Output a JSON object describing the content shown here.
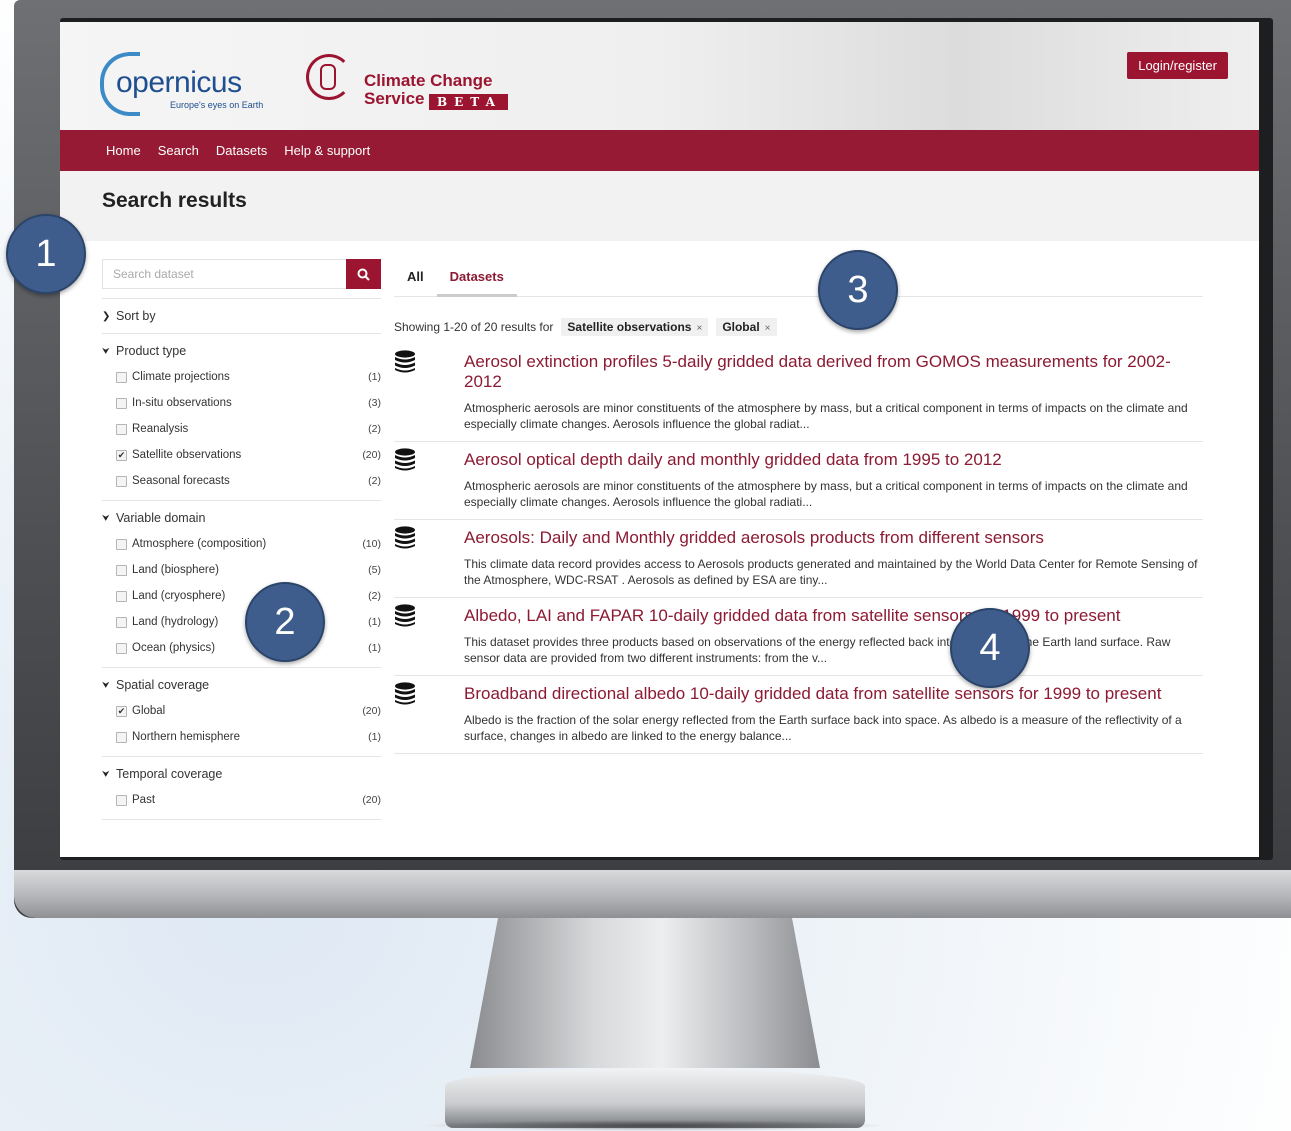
{
  "header": {
    "copernicus_word": "opernicus",
    "copernicus_tagline": "Europe's eyes on Earth",
    "c3s_line1": "Climate Change",
    "c3s_line2": "Service",
    "c3s_beta": "BETA",
    "login_label": "Login/register"
  },
  "nav": {
    "items": [
      "Home",
      "Search",
      "Datasets",
      "Help & support"
    ]
  },
  "page_title": "Search results",
  "search": {
    "placeholder": "Search dataset",
    "value": ""
  },
  "sort_label": "Sort by",
  "facets": [
    {
      "title": "Product type",
      "items": [
        {
          "label": "Climate projections",
          "count": "(1)",
          "checked": false
        },
        {
          "label": "In-situ observations",
          "count": "(3)",
          "checked": false
        },
        {
          "label": "Reanalysis",
          "count": "(2)",
          "checked": false
        },
        {
          "label": "Satellite observations",
          "count": "(20)",
          "checked": true
        },
        {
          "label": "Seasonal forecasts",
          "count": "(2)",
          "checked": false
        }
      ]
    },
    {
      "title": "Variable domain",
      "items": [
        {
          "label": "Atmosphere (composition)",
          "count": "(10)",
          "checked": false
        },
        {
          "label": "Land (biosphere)",
          "count": "(5)",
          "checked": false
        },
        {
          "label": "Land (cryosphere)",
          "count": "(2)",
          "checked": false
        },
        {
          "label": "Land (hydrology)",
          "count": "(1)",
          "checked": false
        },
        {
          "label": "Ocean (physics)",
          "count": "(1)",
          "checked": false
        }
      ]
    },
    {
      "title": "Spatial coverage",
      "items": [
        {
          "label": "Global",
          "count": "(20)",
          "checked": true
        },
        {
          "label": "Northern hemisphere",
          "count": "(1)",
          "checked": false
        }
      ]
    },
    {
      "title": "Temporal coverage",
      "items": [
        {
          "label": "Past",
          "count": "(20)",
          "checked": false
        }
      ]
    }
  ],
  "tabs": [
    "All",
    "Datasets"
  ],
  "active_tab": "Datasets",
  "showing_text": "Showing 1-20 of 20 results for",
  "filter_chips": [
    "Satellite observations",
    "Global"
  ],
  "results": [
    {
      "title": "Aerosol extinction profiles 5-daily gridded data derived from GOMOS measurements for 2002-2012",
      "desc": "Atmospheric aerosols are minor constituents of the atmosphere by mass, but a critical component in terms of impacts on the climate and especially climate changes. Aerosols influence the global radiat..."
    },
    {
      "title": "Aerosol optical depth daily and monthly gridded data from 1995 to 2012",
      "desc": "Atmospheric aerosols are minor constituents of the atmosphere by mass, but a critical component in terms of impacts on the climate and especially climate changes. Aerosols influence the global radiati..."
    },
    {
      "title": "Aerosols: Daily and Monthly gridded aerosols products from different sensors",
      "desc": "This climate data record provides access to Aerosols products generated and maintained by the World Data Center for Remote Sensing of the Atmosphere, WDC-RSAT . Aerosols as defined by ESA are tiny..."
    },
    {
      "title": "Albedo, LAI and FAPAR 10-daily gridded data from satellite sensors for 1999 to present",
      "desc": "This dataset provides three products based on observations of the energy reflected back into space from the Earth land surface. Raw sensor data are provided from two different instruments: from the v..."
    },
    {
      "title": "Broadband directional albedo 10-daily gridded data from satellite sensors for 1999 to present",
      "desc": "Albedo is the fraction of the solar energy reflected from the Earth surface back into space. As albedo is a measure of the reflectivity of a surface, changes in albedo are linked to the energy balance..."
    }
  ],
  "callouts": [
    "1",
    "2",
    "3",
    "4"
  ],
  "colors": {
    "brand": "#961a34",
    "link": "#8c1a33",
    "callout": "#3f5d8c"
  }
}
